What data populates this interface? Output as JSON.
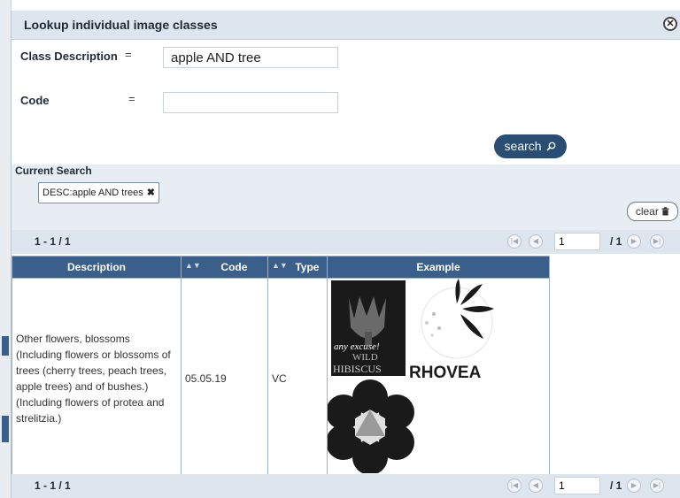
{
  "dialog": {
    "title": "Lookup individual image classes"
  },
  "form": {
    "class_description_label": "Class Description",
    "class_description_eq": "=",
    "class_description_value": "apple AND tree",
    "code_label": "Code",
    "code_eq": "=",
    "code_value": "",
    "search_label": "search"
  },
  "current_search": {
    "title": "Current Search",
    "tag": "DESC:apple AND trees",
    "tag_remove": "✖",
    "clear_label": "clear"
  },
  "pager": {
    "range": "1 - 1 / 1",
    "page_value": "1",
    "total": "/ 1"
  },
  "table": {
    "columns": [
      "Description",
      "Code",
      "Type",
      "Example"
    ],
    "rows": [
      {
        "description": "Other flowers, blossoms (Including flowers or blossoms of trees (cherry trees, peach trees, apple trees) and of bushes.) (Including flowers of protea and strelitzia.)",
        "code": "05.05.19",
        "type": "VC",
        "examples": [
          {
            "name": "wild-hibiscus-logo",
            "text_top": "any excuse!",
            "text_mid": "WILD",
            "text_bottom": "HIBISCUS"
          },
          {
            "name": "rhovea-logo",
            "text": "RHOVEA"
          },
          {
            "name": "hexagon-flower-logo"
          }
        ]
      }
    ]
  },
  "colors": {
    "header_bg": "#3a5f8a",
    "titlebar_bg": "#dde5ee",
    "button_bg": "#294d73"
  }
}
